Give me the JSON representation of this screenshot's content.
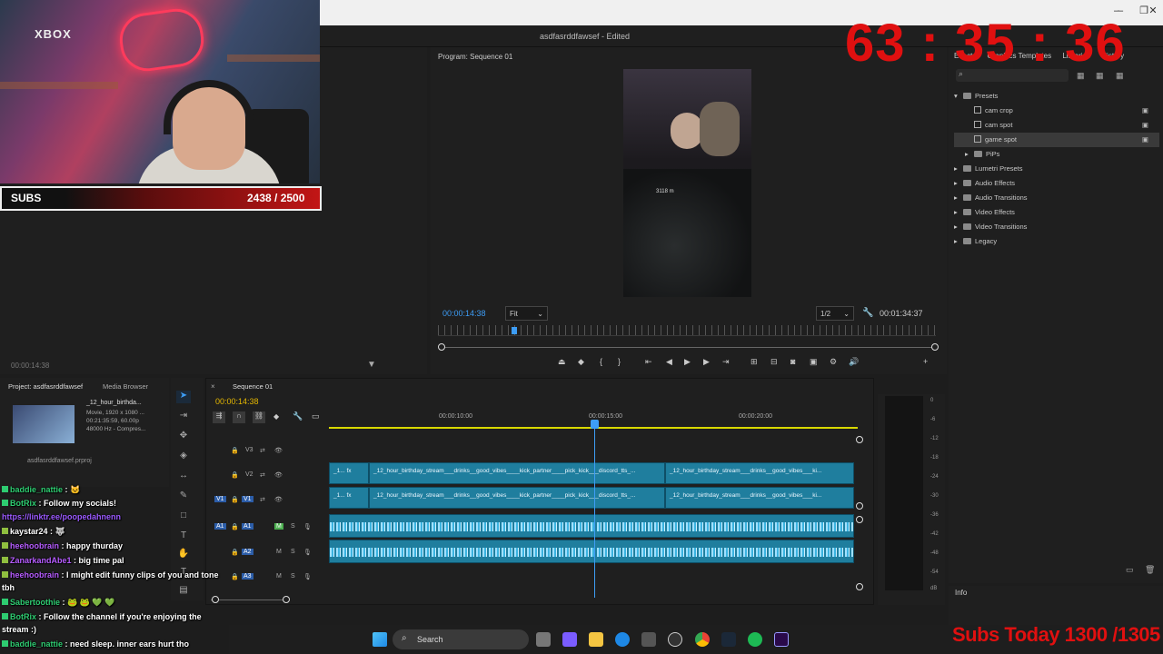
{
  "window": {
    "project_title": "asdfasrddfawsef - Edited",
    "window_buttons": [
      "–",
      "❐",
      "✕"
    ]
  },
  "overlay": {
    "timer": "63 : 35 : 36",
    "subs_label": "SUBS",
    "subs_count": "2438 / 2500",
    "subs_progress": 0.975,
    "xbox_label": "XBOX",
    "subs_today": "Subs Today 1300 /1305"
  },
  "source_monitor": {
    "timecode": "00:00:14:38"
  },
  "program_monitor": {
    "title": "Program: Sequence 01",
    "timecode": "00:00:14:38",
    "fit": "Fit",
    "resolution": "1/2",
    "duration": "00:01:34:37",
    "video_overlay_text": "3118 m"
  },
  "effects": {
    "tabs": [
      "Effects",
      "Graphics Templates",
      "Libraries",
      "History"
    ],
    "tree": [
      {
        "label": "Presets",
        "type": "folder",
        "depth": 0,
        "expanded": true
      },
      {
        "label": "cam crop",
        "type": "preset",
        "depth": 1
      },
      {
        "label": "cam spot",
        "type": "preset",
        "depth": 1
      },
      {
        "label": "game spot",
        "type": "preset",
        "depth": 1
      },
      {
        "label": "PiPs",
        "type": "folder",
        "depth": 1
      },
      {
        "label": "Lumetri Presets",
        "type": "folder",
        "depth": 0
      },
      {
        "label": "Audio Effects",
        "type": "folder",
        "depth": 0
      },
      {
        "label": "Audio Transitions",
        "type": "folder",
        "depth": 0
      },
      {
        "label": "Video Effects",
        "type": "folder",
        "depth": 0
      },
      {
        "label": "Video Transitions",
        "type": "folder",
        "depth": 0
      },
      {
        "label": "Legacy",
        "type": "folder",
        "depth": 0
      }
    ]
  },
  "info": {
    "title": "Info"
  },
  "project": {
    "tab": "Project: asdfasrddfawsef",
    "media_tab": "Media Browser",
    "clip_name": "_12_hour_birthda...",
    "clip_meta": [
      "Movie, 1920 x 1080 ...",
      "00:21:35:59, 60.00p",
      "48000 Hz - Compres..."
    ],
    "prproj": "asdfasrddfawsef.prproj"
  },
  "timeline": {
    "sequence_tab": "Sequence 01",
    "timecode": "00:00:14:38",
    "ruler_labels": [
      "00:00:10:00",
      "00:00:15:00",
      "00:00:20:00"
    ],
    "video_tracks": [
      "V3",
      "V2",
      "V1"
    ],
    "audio_tracks": [
      "A1",
      "A2",
      "A3"
    ],
    "v2_clip_a": "_12_hour_birthday_stream___drinks__good_vibes____kick_partner____pick_kick___discord_tts_...",
    "v2_clip_b": "_12_hour_birthday_stream___drinks__good_vibes___ki...",
    "v1_clip_a": "_12_hour_birthday_stream___drinks__good_vibes____kick_partner____pick_kick___discord_tts_...",
    "v1_clip_b": "_12_hour_birthday_stream___drinks__good_vibes___ki...",
    "meter_db": [
      "0",
      "-6",
      "-12",
      "-18",
      "-24",
      "-30",
      "-36",
      "-42",
      "-48",
      "-54",
      "dB"
    ]
  },
  "chat": [
    {
      "user": "baddie_nattie",
      "color": "#2ecc71",
      "text": " : 🐱"
    },
    {
      "user": "BotRix",
      "color": "#2ecc71",
      "text": " : Follow my socials!"
    },
    {
      "user": "",
      "color": "#9b59ff",
      "text": "https://linktr.ee/poopedahnenn"
    },
    {
      "user": "kaystar24",
      "color": "#ffffff",
      "text": " : 🐺"
    },
    {
      "user": "heehoobrain",
      "color": "#b65cff",
      "text": " : happy thurday"
    },
    {
      "user": "ZanarkandAbe1",
      "color": "#b65cff",
      "text": " : big time pal"
    },
    {
      "user": "heehoobrain",
      "color": "#b65cff",
      "text": " : I might edit funny clips of you and tone"
    },
    {
      "user": "",
      "color": "#ffffff",
      "text": "tbh"
    },
    {
      "user": "Sabertoothie",
      "color": "#2ecc71",
      "text": " : 🐸 🐸 💚 💚"
    },
    {
      "user": "BotRix",
      "color": "#2ecc71",
      "text": " : Follow the channel if you're enjoying the"
    },
    {
      "user": "",
      "color": "#ffffff",
      "text": "stream :)"
    },
    {
      "user": "baddie_nattie",
      "color": "#2ecc71",
      "text": " : need sleep. inner ears hurt tho"
    }
  ],
  "taskbar": {
    "search_label": "Search"
  },
  "colors": {
    "accent_blue": "#3d9df6",
    "timecode_yellow": "#e6b800",
    "clip_teal": "#1f7e9e",
    "alert_red": "#e01010"
  }
}
